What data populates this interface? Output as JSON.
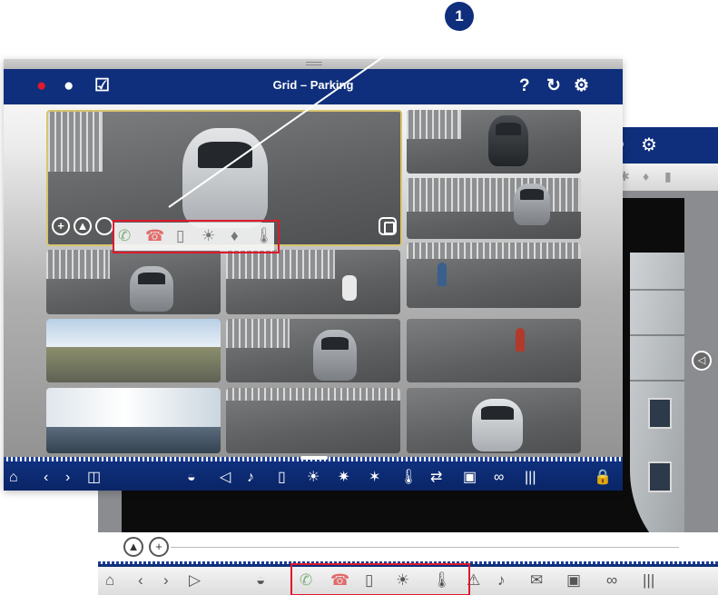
{
  "front_window": {
    "title": "Grid – Parking",
    "header_left_icons": [
      "user-alert-icon",
      "chat-bubble-icon",
      "checkbox-icon"
    ],
    "header_right_icons": [
      "help-icon",
      "refresh-icon",
      "settings-gear-icon"
    ],
    "help_glyph": "?",
    "refresh_glyph": "↻",
    "gear_glyph": "⚙",
    "tiles": [
      "parking-big",
      "parking-dark-car",
      "parking-gate-car",
      "parking-fence-car",
      "parking-scooter",
      "parking-cyclist",
      "field-panorama",
      "parking-grey-car",
      "parking-walker",
      "lobby-interior",
      "parking-gate",
      "parking-silver-car"
    ],
    "camera_overlay_icons": [
      "zoom-in-icon",
      "mountains-icon",
      "circle-icon",
      "door-icon"
    ],
    "door_station_icons": [
      "phone-accept-icon",
      "phone-hangup-icon",
      "door-icon",
      "light-icon",
      "lamp-icon",
      "thermometer-icon"
    ],
    "toolbar_icons": [
      "home-icon",
      "back-icon",
      "forward-icon",
      "layout-icon",
      "dome-camera-icon",
      "speaker-icon",
      "microphone-icon",
      "door-icon",
      "light-icon",
      "light-off-icon",
      "light-auto-icon",
      "thermometer-icon",
      "transfer-icon",
      "snapshot-icon",
      "link-icon",
      "barcode-icon",
      "lock-icon"
    ]
  },
  "back_window": {
    "header_icons": [
      "refresh-icon",
      "settings-gear-icon"
    ],
    "refresh_glyph": "↻",
    "gear_glyph": "⚙",
    "side_button_icon": "speaker-icon",
    "bottom_controls": [
      "mountains-icon",
      "zoom-in-icon"
    ],
    "zoom_glyph": "+",
    "toolbar_icons": [
      "home-icon",
      "back-icon",
      "forward-icon",
      "play-icon",
      "dome-camera-icon",
      "phone-accept-icon",
      "phone-hangup-icon",
      "door-icon",
      "light-icon",
      "thermometer-icon",
      "alarm-light-icon",
      "bell-icon",
      "mail-icon",
      "snapshot-icon",
      "link-icon",
      "barcode-icon"
    ]
  },
  "callout": {
    "number": "1"
  }
}
